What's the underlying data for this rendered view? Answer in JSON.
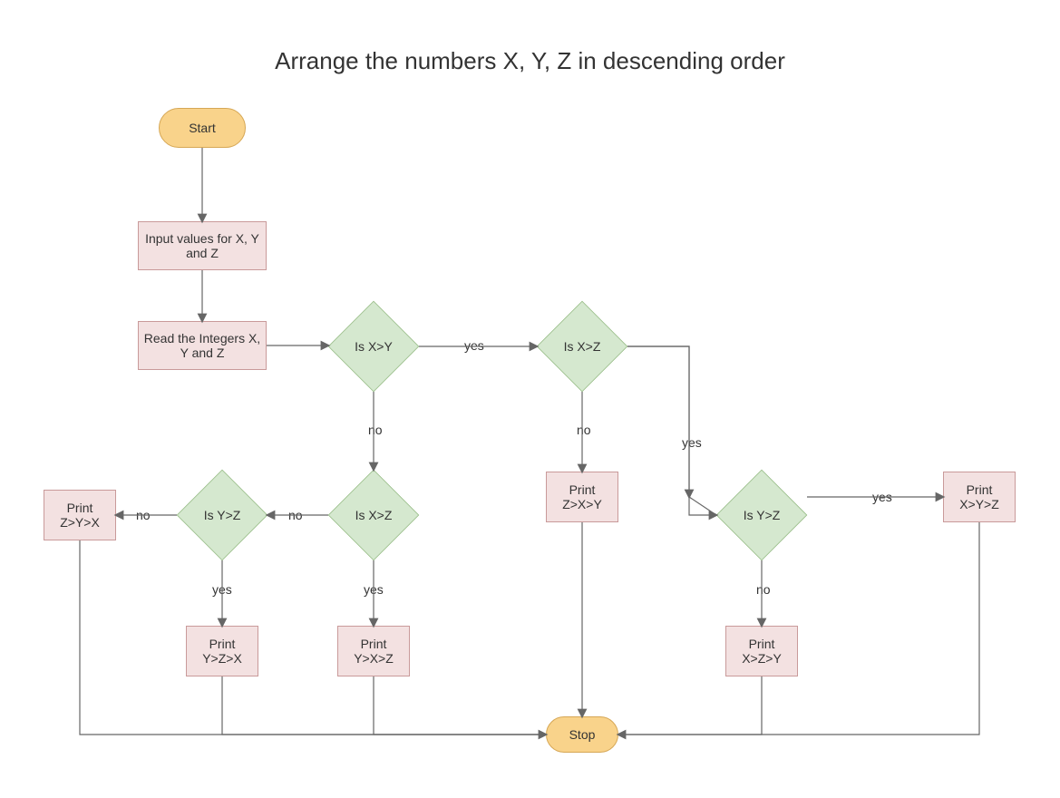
{
  "title": "Arrange the numbers X, Y, Z in descending order",
  "nodes": {
    "start": "Start",
    "input": "Input values for X, Y and Z",
    "read": "Read the Integers X, Y and Z",
    "d_xy": "Is X>Y",
    "d_xz_top": "Is X>Z",
    "d_yz_left": "Is Y>Z",
    "d_xz_bottom": "Is X>Z",
    "d_yz_right": "Is Y>Z",
    "p_zyx": "Print\nZ>Y>X",
    "p_yzx": "Print\nY>Z>X",
    "p_yxz": "Print\nY>X>Z",
    "p_zxy": "Print\nZ>X>Y",
    "p_xzy": "Print\nX>Z>Y",
    "p_xyz": "Print\nX>Y>Z",
    "stop": "Stop"
  },
  "labels": {
    "yes": "yes",
    "no": "no"
  }
}
